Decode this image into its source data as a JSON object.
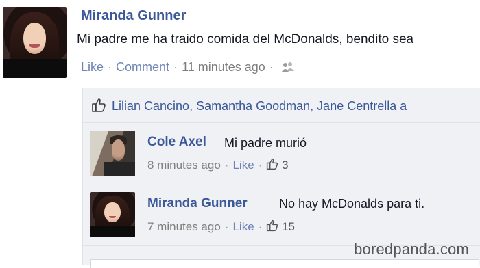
{
  "post": {
    "author": "Miranda Gunner",
    "text": "Mi padre me ha traido comida del McDonalds, bendito sea",
    "actions": {
      "like": "Like",
      "comment": "Comment",
      "time": "11 minutes ago"
    }
  },
  "likes": {
    "names": "Lilian Cancino, Samantha Goodman, Jane Centrella a"
  },
  "comments": [
    {
      "author": "Cole Axel",
      "text": "Mi padre murió",
      "time": "8 minutes ago",
      "like": "Like",
      "like_count": "3"
    },
    {
      "author": "Miranda Gunner",
      "text": "No hay McDonalds para ti.",
      "time": "7 minutes ago",
      "like": "Like",
      "like_count": "15"
    }
  ],
  "watermark": "boredpanda.com",
  "colors": {
    "link": "#3b5998",
    "muted": "#7f7f7f",
    "comment_bg": "#f0f1f5"
  },
  "icons": {
    "audience": "friends-icon",
    "like": "thumbs-up-icon"
  }
}
